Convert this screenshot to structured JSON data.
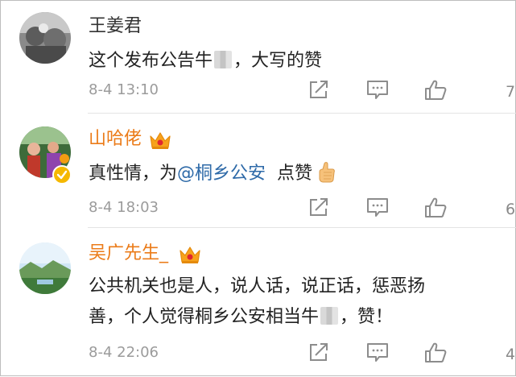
{
  "comments": [
    {
      "username": "王姜君",
      "text_before": "这个发布公告牛",
      "text_after": "，大写的赞",
      "time": "8-4 13:10",
      "likes": "7",
      "verified": false,
      "vip": false
    },
    {
      "username": "山哈佬",
      "text_before": "真性情，为",
      "mention": "@桐乡公安",
      "text_after": "点赞",
      "time": "8-4 18:03",
      "likes": "6",
      "verified": true,
      "vip": true
    },
    {
      "username": "吴广先生_",
      "line1": "公共机关也是人，说人话，说正话，惩恶扬",
      "line2_before": "善，个人觉得桐乡公安相当牛",
      "line2_after": "，赞！",
      "time": "8-4 22:06",
      "likes": "4",
      "verified": false,
      "vip": true
    }
  ],
  "colors": {
    "vip_name": "#eb7b18",
    "mention": "#2e6aa8",
    "meta_text": "#9b9b9b"
  },
  "icons": [
    "share-icon",
    "comment-icon",
    "like-icon",
    "vip-crown-icon",
    "thumbs-up-emoji-icon",
    "verified-badge-icon"
  ]
}
